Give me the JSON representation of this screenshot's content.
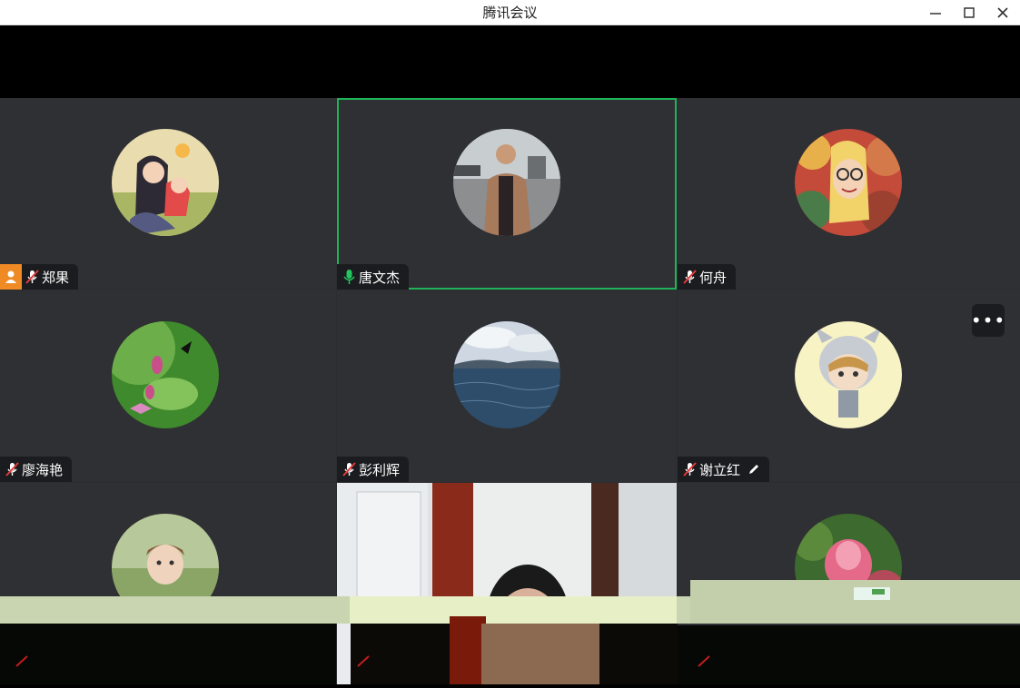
{
  "window": {
    "title": "腾讯会议",
    "controls": {
      "minimize": "—",
      "maximize": "☐",
      "close": "✕"
    }
  },
  "participants": [
    {
      "name": "郑果",
      "mic": "muted",
      "host": true
    },
    {
      "name": "唐文杰",
      "mic": "active",
      "speaking": true
    },
    {
      "name": "何舟",
      "mic": "muted"
    },
    {
      "name": "廖海艳",
      "mic": "muted"
    },
    {
      "name": "彭利辉",
      "mic": "muted"
    },
    {
      "name": "谢立红",
      "mic": "muted",
      "editing": true
    },
    {
      "name": "",
      "mic": "muted"
    },
    {
      "name": "",
      "mic": "muted",
      "video": true
    },
    {
      "name": "",
      "mic": "muted"
    }
  ],
  "more_button_label": "•••",
  "colors": {
    "active_border": "#1fb35a",
    "host_badge": "#f08a24",
    "tile_bg": "#2f3033"
  }
}
